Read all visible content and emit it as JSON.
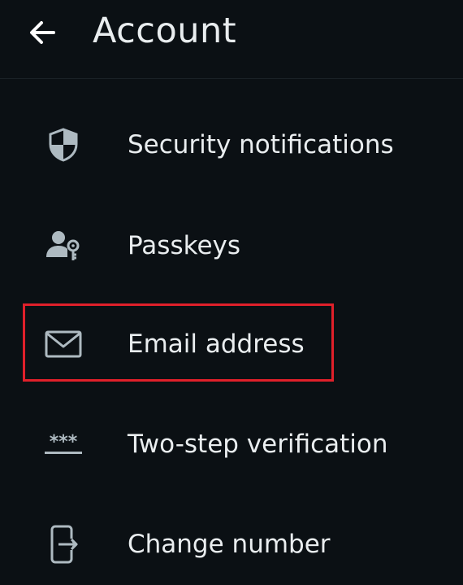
{
  "header": {
    "back_icon": "arrow-left-icon",
    "title": "Account"
  },
  "menu": {
    "items": [
      {
        "icon": "shield-icon",
        "label": "Security notifications"
      },
      {
        "icon": "passkey-icon",
        "label": "Passkeys"
      },
      {
        "icon": "envelope-icon",
        "label": "Email address"
      },
      {
        "icon": "password-dots-icon",
        "label": "Two-step verification"
      },
      {
        "icon": "phone-transfer-icon",
        "label": "Change number"
      }
    ]
  },
  "annotation": {
    "highlighted_item": "Email address",
    "highlight_color": "#e0202a"
  },
  "colors": {
    "background": "#0b1014",
    "text": "#e9edef",
    "icon": "#aebac1"
  }
}
